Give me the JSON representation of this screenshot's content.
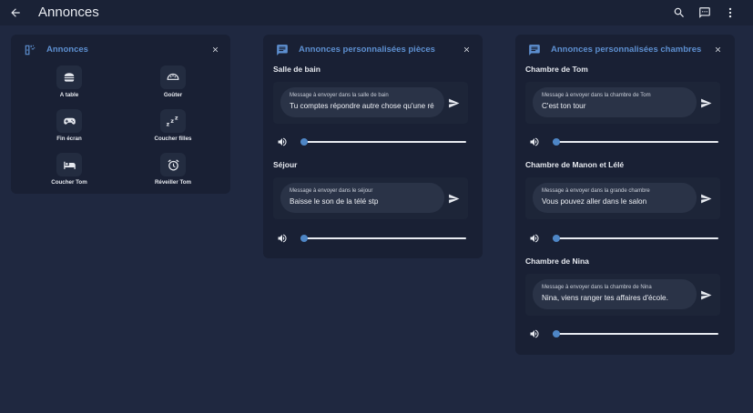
{
  "app": {
    "title": "Annonces"
  },
  "toolbar": {
    "back_icon": "arrow-left-icon",
    "search_icon": "search-icon",
    "assist_icon": "message-icon",
    "menu_icon": "more-vertical-icon"
  },
  "colors": {
    "background": "#1f2840",
    "card": "#192034",
    "accent": "#5d8fd0",
    "slider": "#4e86c6"
  },
  "annonces_card": {
    "title": "Annonces",
    "icon": "scene-icon",
    "close_icon": "close-icon",
    "shortcuts": [
      {
        "label": "A table",
        "icon": "hamburger-icon"
      },
      {
        "label": "Goûter",
        "icon": "cookie-icon"
      },
      {
        "label": "Fin écran",
        "icon": "gamepad-icon"
      },
      {
        "label": "Coucher filles",
        "icon": "sleep-icon"
      },
      {
        "label": "Coucher Tom",
        "icon": "bed-icon"
      },
      {
        "label": "Réveiller Tom",
        "icon": "alarm-icon"
      }
    ]
  },
  "pieces_card": {
    "title": "Annonces personnalisées pièces",
    "icon": "message-icon",
    "close_icon": "close-icon",
    "sections": [
      {
        "title": "Salle de bain",
        "field_label": "Message à envoyer dans la salle de bain",
        "value": "Tu comptes répondre autre chose qu'une ré",
        "volume": 0
      },
      {
        "title": "Séjour",
        "field_label": "Message à envoyer dans le séjour",
        "value": "Baisse le son de la télé stp",
        "volume": 0
      }
    ]
  },
  "chambres_card": {
    "title": "Annonces personnalisées chambres",
    "icon": "message-icon",
    "close_icon": "close-icon",
    "sections": [
      {
        "title": "Chambre de Tom",
        "field_label": "Message à envoyer dans la chambre de Tom",
        "value": "C'est ton tour",
        "volume": 0
      },
      {
        "title": "Chambre de Manon et Lélé",
        "field_label": "Message à envoyer dans la grande chambre",
        "value": "Vous pouvez aller dans le salon",
        "volume": 0
      },
      {
        "title": "Chambre de Nina",
        "field_label": "Message à envoyer dans la chambre de Nina",
        "value": "Nina, viens ranger tes affaires d'école.",
        "volume": 0
      }
    ]
  }
}
